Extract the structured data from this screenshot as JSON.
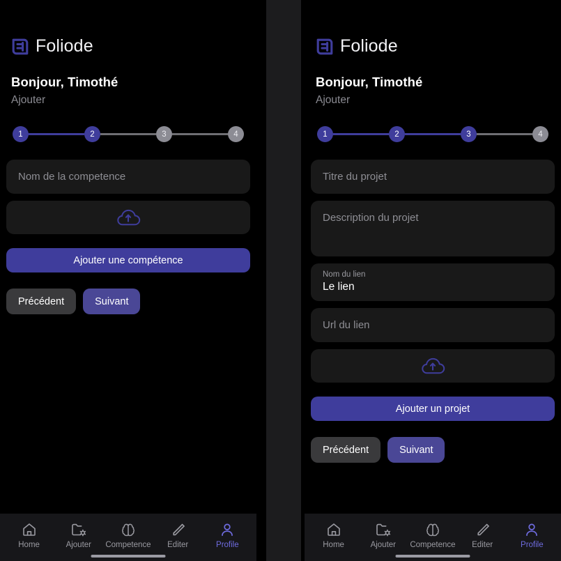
{
  "theme": {
    "accent": "#3f3d9c",
    "accent_text": "#6f6ce0",
    "panel_bg": "#000000",
    "field_bg": "#191919",
    "nav_bg": "#17171a",
    "step_off": "#8c8c94",
    "muted_text": "#8e8e94"
  },
  "brand": {
    "name": "Foliode",
    "logo_icon": "foliode-logo-icon"
  },
  "left_panel": {
    "greeting": "Bonjour, Timothé",
    "subtitle": "Ajouter",
    "stepper": {
      "steps": [
        "1",
        "2",
        "3",
        "4"
      ],
      "active_count": 2
    },
    "fields": [
      {
        "name": "skill-name",
        "placeholder": "Nom de la competence"
      }
    ],
    "upload": {
      "icon": "cloud-upload-icon"
    },
    "primary_label": "Ajouter une compétence",
    "prev_label": "Précédent",
    "next_label": "Suivant"
  },
  "right_panel": {
    "greeting": "Bonjour, Timothé",
    "subtitle": "Ajouter",
    "stepper": {
      "steps": [
        "1",
        "2",
        "3",
        "4"
      ],
      "active_count": 3
    },
    "fields": [
      {
        "name": "project-title",
        "placeholder": "Titre du projet"
      },
      {
        "name": "project-description",
        "placeholder": "Description du projet"
      },
      {
        "name": "link-name",
        "label": "Nom du lien",
        "value": "Le lien"
      },
      {
        "name": "link-url",
        "placeholder": "Url du lien"
      }
    ],
    "upload": {
      "icon": "cloud-upload-icon"
    },
    "primary_label": "Ajouter un projet",
    "prev_label": "Précédent",
    "next_label": "Suivant"
  },
  "bottom_nav": {
    "items": [
      {
        "label": "Home",
        "icon": "home-icon",
        "active": false
      },
      {
        "label": "Ajouter",
        "icon": "folder-gear-icon",
        "active": false
      },
      {
        "label": "Competence",
        "icon": "brain-icon",
        "active": false
      },
      {
        "label": "Editer",
        "icon": "pencil-icon",
        "active": false
      },
      {
        "label": "Profile",
        "icon": "person-icon",
        "active": true
      }
    ]
  }
}
